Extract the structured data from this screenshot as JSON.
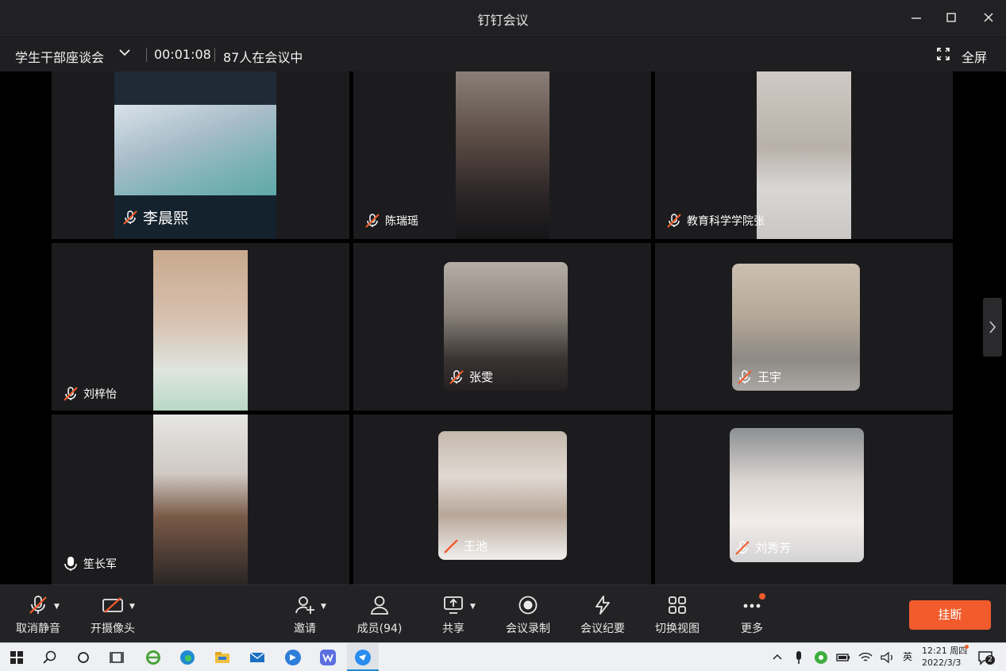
{
  "window": {
    "title": "钉钉会议"
  },
  "infobar": {
    "meeting_name": "学生干部座谈会",
    "timer": "00:01:08",
    "participants_in_meeting": "87人在会议中",
    "fullscreen_label": "全屏"
  },
  "participants": [
    {
      "name": "李晨熙",
      "mic": "muted"
    },
    {
      "name": "陈瑞瑶",
      "mic": "muted"
    },
    {
      "name": "教育科学学院张",
      "mic": "muted"
    },
    {
      "name": "刘梓怡",
      "mic": "muted"
    },
    {
      "name": "张雯",
      "mic": "muted"
    },
    {
      "name": "王宇",
      "mic": "muted"
    },
    {
      "name": "笙长军",
      "mic": "on"
    },
    {
      "name": "王池",
      "mic": "muted"
    },
    {
      "name": "刘秀芳",
      "mic": "muted"
    }
  ],
  "toolbar": {
    "mute_label": "取消静音",
    "camera_label": "开摄像头",
    "invite_label": "邀请",
    "members_label": "成员(94)",
    "share_label": "共享",
    "record_label": "会议录制",
    "minutes_label": "会议纪要",
    "view_label": "切换视图",
    "more_label": "更多",
    "hangup_label": "挂断"
  },
  "taskbar": {
    "time": "12:21 周四",
    "date": "2022/3/3",
    "ime": "英",
    "notifications": "2"
  },
  "colors": {
    "accent": "#f25b2b",
    "tile_bg": "#1c1c1e",
    "window_bg": "#1b1b1d"
  }
}
